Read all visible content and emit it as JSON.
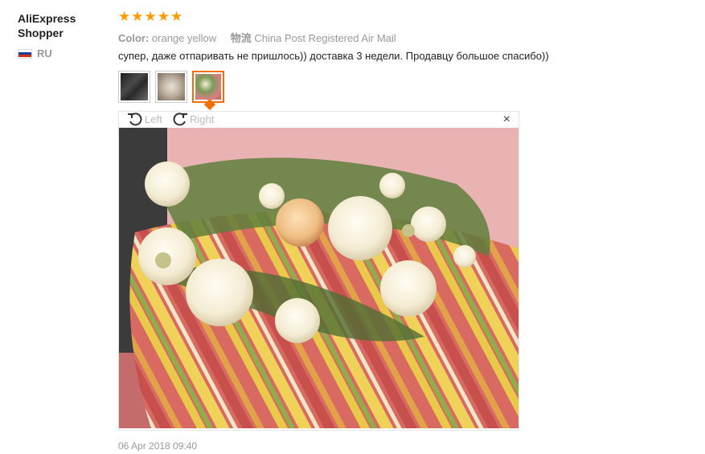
{
  "reviewer": {
    "name": "AliExpress Shopper",
    "country_code": "RU"
  },
  "rating": {
    "stars": 5,
    "max": 5,
    "color": "#ff9a00"
  },
  "attributes": {
    "color_label": "Color:",
    "color_value": "orange yellow",
    "shipping_label": "物流",
    "shipping_value": "China Post Registered Air Mail"
  },
  "review": {
    "text": "супер, даже отпаривать не пришлось)) доставка 3 недели. Продавцу большое спасибо))"
  },
  "thumbnails": {
    "count": 3,
    "selected_index": 2
  },
  "viewer": {
    "rotate_left_label": "Left",
    "rotate_right_label": "Right",
    "close_label": "×"
  },
  "date": "06 Apr 2018 09:40",
  "colors": {
    "accent": "#f36d00",
    "muted": "#999999"
  }
}
